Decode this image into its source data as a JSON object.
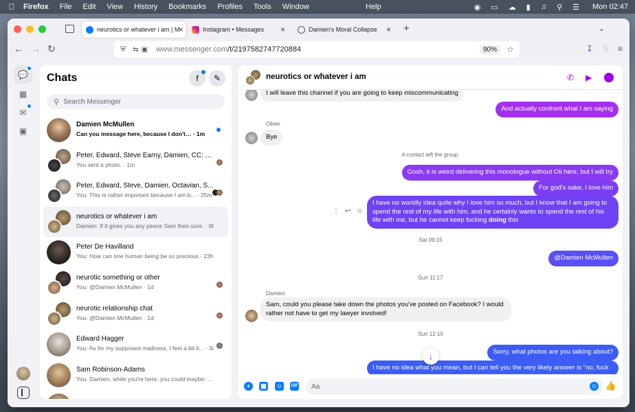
{
  "colors": {
    "messenger_blue": "#0a7cff",
    "accent_purple": "#a100e8",
    "bubble_gradient_top": "#a33cf0",
    "bubble_gradient_bottom": "#3b5cf5",
    "incoming_bubble": "#f0f0f0"
  },
  "menubar": {
    "app": "Firefox",
    "items": [
      "File",
      "Edit",
      "View",
      "History",
      "Bookmarks",
      "Profiles",
      "Tools",
      "Window"
    ],
    "help": "Help",
    "clock": "Mon 02:47"
  },
  "browser": {
    "tabs": [
      {
        "title": "neurotics or whatever i am | Mes",
        "icon": "messenger-icon",
        "active": true
      },
      {
        "title": "Instagram • Messages",
        "icon": "instagram-icon",
        "active": false
      },
      {
        "title": "Damien's Moral Collapse",
        "icon": "globe-icon",
        "active": false
      }
    ],
    "url_prefix": "www.messenger.com",
    "url_path": "/t/2197582747720884",
    "zoom": "90%"
  },
  "chats": {
    "heading": "Chats",
    "search_placeholder": "Search Messenger",
    "conversations": [
      {
        "name": "Damien McMullen",
        "snippet": "Can you message here, because I don't… · 1m",
        "unread": true,
        "group": false
      },
      {
        "name": "Peter, Edward, Steve Earny, Damien, CC: M...",
        "snippet": "You sent a photo. · 1m",
        "unread": false,
        "group": true
      },
      {
        "name": "Peter, Edward, Steve, Damien, Octavian, S...",
        "snippet": "You: This is rather important because I am b... · 25m",
        "unread": false,
        "group": true
      },
      {
        "name": "neurotics or whatever i am",
        "snippet": "Damien: If it gives you any peace Sam then sure. · 9h",
        "unread": false,
        "group": true,
        "selected": true
      },
      {
        "name": "Peter De Havilland",
        "snippet": "You: How can one human being be so precious · 23h",
        "unread": false,
        "group": false
      },
      {
        "name": "neurotic something or other",
        "snippet": "You: @Damien McMullen · 1d",
        "unread": false,
        "group": true
      },
      {
        "name": "neurotic relationship chat",
        "snippet": "You: @Damien McMullen · 1d",
        "unread": false,
        "group": true
      },
      {
        "name": "Edward Hagger",
        "snippet": "You: As for my supposed madness, I feel a bit li... · 3d",
        "unread": false,
        "group": false
      },
      {
        "name": "Sam Robinson-Adams",
        "snippet": "You: Damien, while you're here, you could maybe: ... · 4d",
        "unread": false,
        "group": false
      }
    ]
  },
  "conversation": {
    "title": "neurotics or whatever i am",
    "messages": {
      "m0": "I will leave this channel if you are going to keep miscommunicating",
      "m1": "And actually confront what I am saying",
      "oliver_name": "Oliver",
      "m2": "Bye",
      "system": "A contact left the group.",
      "m3": "Gosh, it is weird delivering this monologue without Oli here, but I will try",
      "m4": "For god's sake, I love him",
      "m5_line1": "I have no worldly idea quite why I love him so much, but I know that I am going to",
      "m5_line2": "spend the rest of my life with him, and he certainly wants to spend the rest of his",
      "m5_line3a": "life with me, but he cannot keep fucking ",
      "m5_line3b": "doing",
      "m5_line3c": " this",
      "ts1": "Sat 09:15",
      "m6": "@Damien McMullen",
      "ts2": "Sun 11:17",
      "damien_name": "Damien",
      "m7_line1": "Sam, could you please take down the photos you've posted on Facebook? I would",
      "m7_line2": "rather not have to get my lawyer involved!",
      "ts3": "Sun 12:10",
      "m8": "Sorry, what photos are you talking about?",
      "m9": "I have no idea what you mean, but I can tell you the very likely answer is \"no, fuck"
    },
    "composer_placeholder": "Aa"
  }
}
